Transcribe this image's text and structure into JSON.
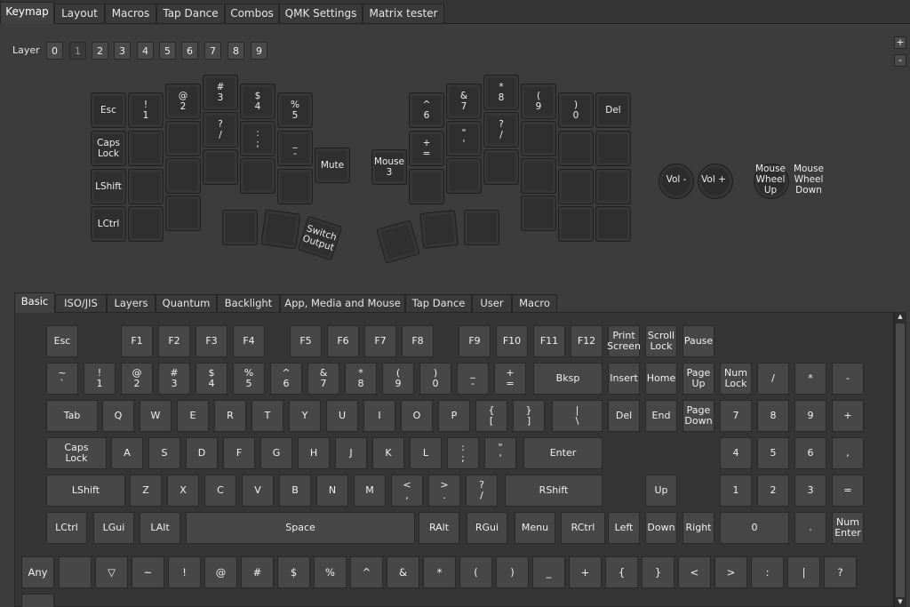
{
  "top_tabs": [
    "Keymap",
    "Layout",
    "Macros",
    "Tap Dance",
    "Combos",
    "QMK Settings",
    "Matrix tester"
  ],
  "layer": {
    "label": "Layer",
    "buttons": [
      "0",
      "1",
      "2",
      "3",
      "4",
      "5",
      "6",
      "7",
      "8",
      "9"
    ],
    "active": "1"
  },
  "side_buttons": {
    "plus": "+",
    "minus": "-"
  },
  "keymap_keys": [
    "Esc",
    "!\n1",
    "@\n2",
    "#\n3",
    "$\n4",
    "%\n5",
    "Caps\nLock",
    "",
    "",
    "?\n/",
    ":\n;",
    "_\n-",
    "Mute",
    "LShift",
    "",
    "",
    "",
    "",
    "",
    "LCtrl",
    "",
    "",
    "",
    "",
    "Switch\nOutput",
    "^\n6",
    "&\n7",
    "*\n8",
    "(\n9",
    ")\n0",
    "Del",
    "Mouse\n3",
    "+\n=",
    "\"\n'",
    "?\n/",
    "",
    "",
    "",
    "",
    "",
    "",
    "",
    "",
    "",
    "",
    "",
    "",
    "",
    "",
    "",
    "",
    "",
    ""
  ],
  "encoders": [
    {
      "left": "Vol -",
      "right": "Vol +"
    },
    {
      "left": "Mouse\nWheel\nUp",
      "right": "Mouse\nWheel\nDown"
    }
  ],
  "bottom_tabs": [
    "Basic",
    "ISO/JIS",
    "Layers",
    "Quantum",
    "Backlight",
    "App, Media and Mouse",
    "Tap Dance",
    "User",
    "Macro"
  ],
  "basic_keys": {
    "row1": [
      "Esc",
      "F1",
      "F2",
      "F3",
      "F4",
      "F5",
      "F6",
      "F7",
      "F8",
      "F9",
      "F10",
      "F11",
      "F12",
      "Print\nScreen",
      "Scroll\nLock",
      "Pause"
    ],
    "row2": [
      "~\n`",
      "!\n1",
      "@\n2",
      "#\n3",
      "$\n4",
      "%\n5",
      "^\n6",
      "&\n7",
      "*\n8",
      "(\n9",
      ")\n0",
      "_\n-",
      "+\n=",
      "Bksp",
      "Insert",
      "Home",
      "Page\nUp",
      "Num\nLock",
      "/",
      "*",
      "-"
    ],
    "row3": [
      "Tab",
      "Q",
      "W",
      "E",
      "R",
      "T",
      "Y",
      "U",
      "I",
      "O",
      "P",
      "{\n[",
      "}\n]",
      "|\n\\",
      "Del",
      "End",
      "Page\nDown",
      "7",
      "8",
      "9",
      "+"
    ],
    "row4": [
      "Caps\nLock",
      "A",
      "S",
      "D",
      "F",
      "G",
      "H",
      "J",
      "K",
      "L",
      ":\n;",
      "\"\n'",
      "Enter",
      "4",
      "5",
      "6",
      ","
    ],
    "row5": [
      "LShift",
      "Z",
      "X",
      "C",
      "V",
      "B",
      "N",
      "M",
      "<\n,",
      ">\n.",
      "?\n/",
      "RShift",
      "Up",
      "1",
      "2",
      "3",
      "="
    ],
    "row6": [
      "LCtrl",
      "LGui",
      "LAlt",
      "Space",
      "RAlt",
      "RGui",
      "Menu",
      "RCtrl",
      "Left",
      "Down",
      "Right",
      "0",
      ".",
      "Num\nEnter"
    ],
    "row7": [
      "Any",
      "",
      "▽",
      "~",
      "!",
      "@",
      "#",
      "$",
      "%",
      "^",
      "&",
      "*",
      "(",
      ")",
      "_",
      "+",
      "{",
      "}",
      "<",
      ">",
      ":",
      "|",
      "?"
    ]
  },
  "scroll": {
    "up": "▲",
    "down": "▼"
  }
}
